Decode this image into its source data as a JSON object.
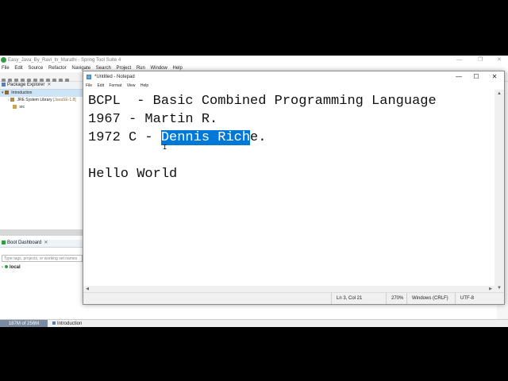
{
  "ide": {
    "title": "Easy_Java_By_Ravi_In_Marathi - Spring Tool Suite 4",
    "window_controls": [
      "—",
      "❐",
      "✕"
    ],
    "menu": [
      "File",
      "Edit",
      "Source",
      "Refactor",
      "Navigate",
      "Search",
      "Project",
      "Run",
      "Window",
      "Help"
    ],
    "package_explorer": {
      "tab_label": "Package Explorer",
      "items": [
        {
          "label": "Introduction"
        },
        {
          "label": "JRE System Library",
          "suffix": "[JavaSE-1.8]"
        },
        {
          "label": "src"
        }
      ]
    },
    "boot_dashboard": {
      "tab_label": "Boot Dashboard",
      "filter_placeholder": "Type tags, projects, or working set names",
      "item": "local"
    },
    "status": {
      "heap": "187M of 256M",
      "selection": "Introduction"
    }
  },
  "notepad": {
    "title": "*Untitled - Notepad",
    "controls": [
      "—",
      "☐",
      "✕"
    ],
    "menu": [
      "File",
      "Edit",
      "Format",
      "View",
      "Help"
    ],
    "lines": {
      "l1": "BCPL  - Basic Combined Programming Language",
      "l2": "1967 - Martin R.",
      "l3_before": "1972 C - ",
      "l3_selected": "Dennis Rich",
      "l3_after": "e.",
      "l5": "Hello World"
    },
    "caret": "I",
    "status": {
      "position": "Ln 3, Col 21",
      "zoom": "270%",
      "line_ending": "Windows (CRLF)",
      "encoding": "UTF-8"
    }
  }
}
